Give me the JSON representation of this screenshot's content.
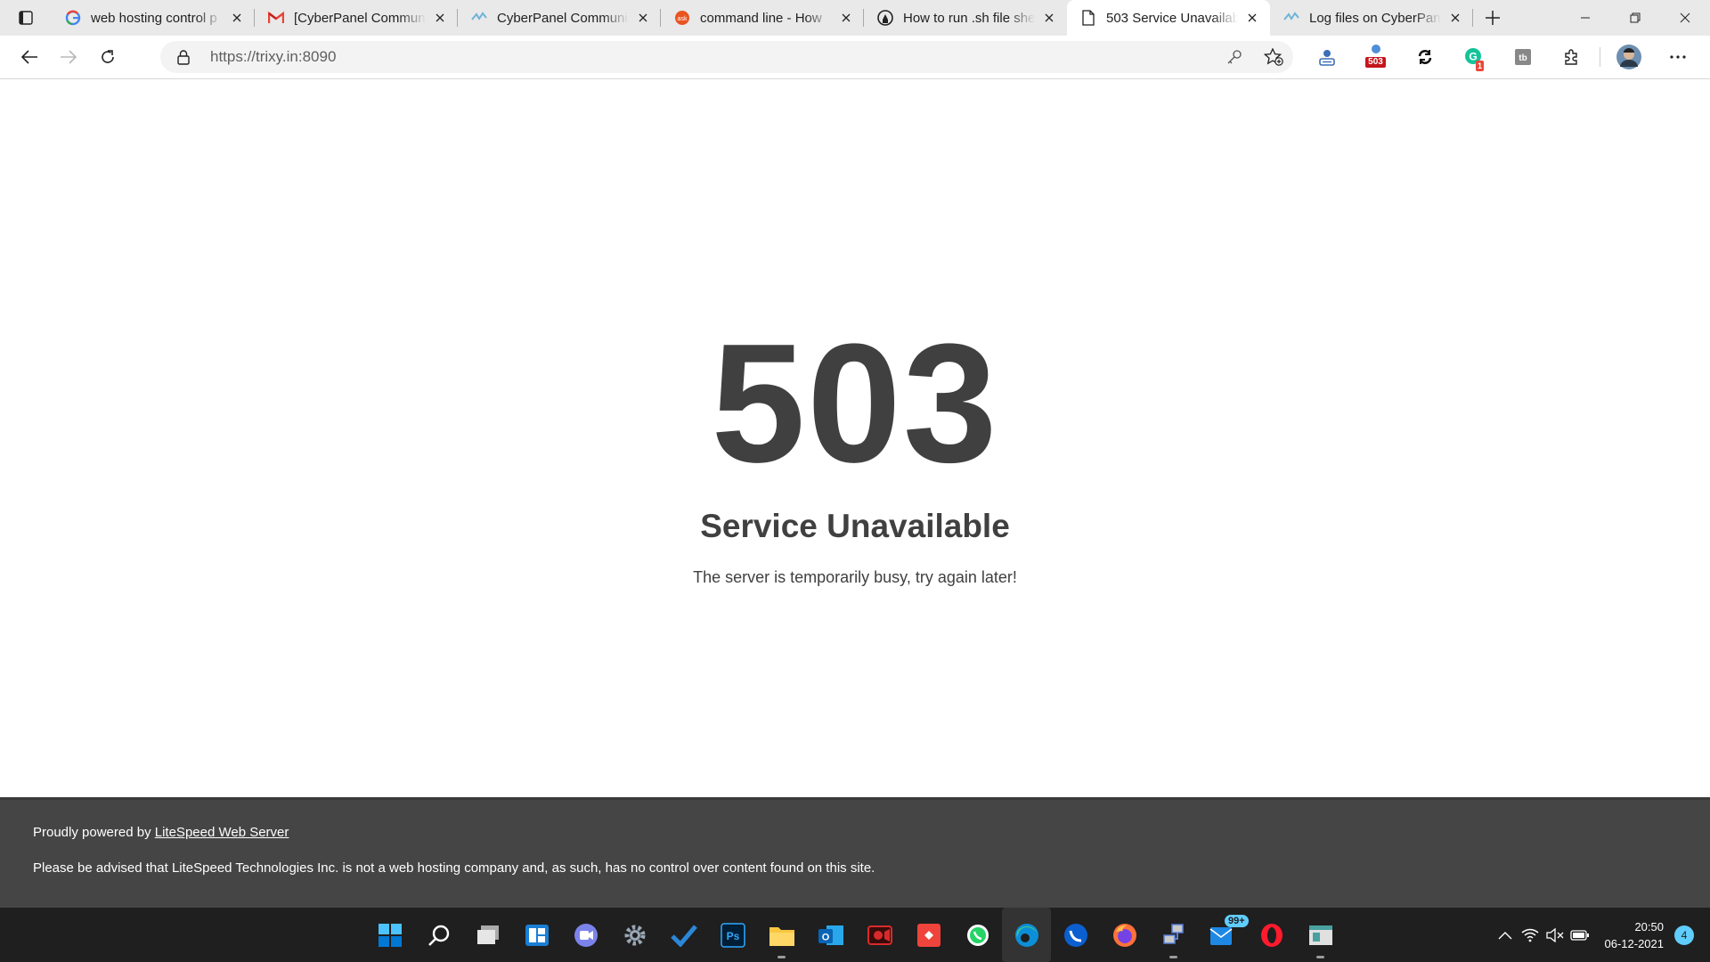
{
  "browser": {
    "tabs": [
      {
        "title": "web hosting control p",
        "favicon": "google-icon"
      },
      {
        "title": "[CyberPanel Commun",
        "favicon": "gmail-icon"
      },
      {
        "title": "CyberPanel Communi",
        "favicon": "cyberpanel-icon"
      },
      {
        "title": "command line - How",
        "favicon": "askubuntu-icon"
      },
      {
        "title": "How to run .sh file she",
        "favicon": "github-icon"
      },
      {
        "title": "503 Service Unavailab",
        "favicon": "page-icon"
      },
      {
        "title": "Log files on CyberPan",
        "favicon": "cyberpanel-icon"
      }
    ],
    "active_tab_index": 5,
    "address_bar": {
      "url": "https://trixy.in:8090"
    },
    "extensions": [
      {
        "name": "extension-user-icon"
      },
      {
        "name": "extension-status-503-icon",
        "badge": "503"
      },
      {
        "name": "extension-sync-icon"
      },
      {
        "name": "extension-grammarly-icon",
        "badge": "1"
      },
      {
        "name": "extension-tb-icon"
      },
      {
        "name": "extensions-puzzle-icon"
      }
    ]
  },
  "page": {
    "code": "503",
    "headline": "Service Unavailable",
    "message": "The server is temporarily busy, try again later!",
    "footer": {
      "powered_prefix": "Proudly powered by",
      "powered_link": "LiteSpeed Web Server",
      "disclaimer": "Please be advised that LiteSpeed Technologies Inc. is not a web hosting company and, as such, has no control over content found on this site."
    }
  },
  "taskbar": {
    "apps": [
      "start",
      "search",
      "task-view",
      "widgets",
      "teams-chat",
      "settings",
      "todo",
      "photoshop",
      "file-explorer",
      "outlook",
      "screen-recorder",
      "anydesk",
      "whatsapp",
      "edge",
      "skype-like",
      "firefox",
      "network",
      "mail",
      "opera",
      "notepad"
    ],
    "mail_badge": "99+",
    "clock": {
      "time": "20:50",
      "date": "06-12-2021"
    },
    "notifications": "4"
  },
  "colors": {
    "text": "#404040",
    "footer_bg": "#454545",
    "taskbar_bg": "#1f1f1f",
    "accent": "#60cdff"
  }
}
